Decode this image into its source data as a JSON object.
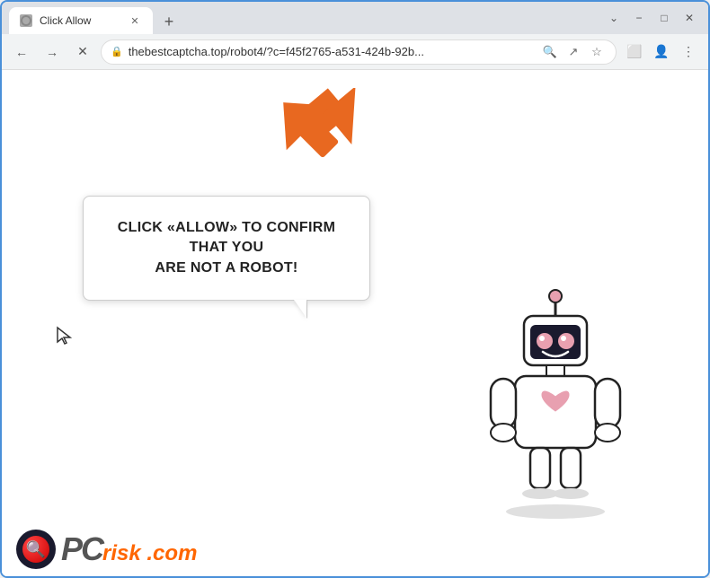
{
  "browser": {
    "tab": {
      "label": "Click Allow",
      "favicon": "page-icon"
    },
    "new_tab_label": "+",
    "window_controls": {
      "minimize": "−",
      "maximize": "□",
      "close": "✕",
      "chevron": "⌄"
    },
    "address_bar": {
      "url": "thebestcaptcha.top/robot4/?c=f45f2765-a531-424b-92b...",
      "lock_icon": "🔒"
    },
    "nav": {
      "back": "←",
      "forward": "→",
      "reload": "✕"
    },
    "toolbar": {
      "search_icon": "🔍",
      "share_icon": "↗",
      "bookmark_icon": "☆",
      "extension_icon": "⬜",
      "profile_icon": "👤",
      "menu_icon": "⋮"
    }
  },
  "page": {
    "bubble_text_line1": "CLICK «ALLOW» TO CONFIRM THAT YOU",
    "bubble_text_line2": "ARE NOT A ROBOT!",
    "watermark": {
      "pc_text": "PC",
      "risk_text": "risk",
      "dot_com": ".com"
    }
  }
}
